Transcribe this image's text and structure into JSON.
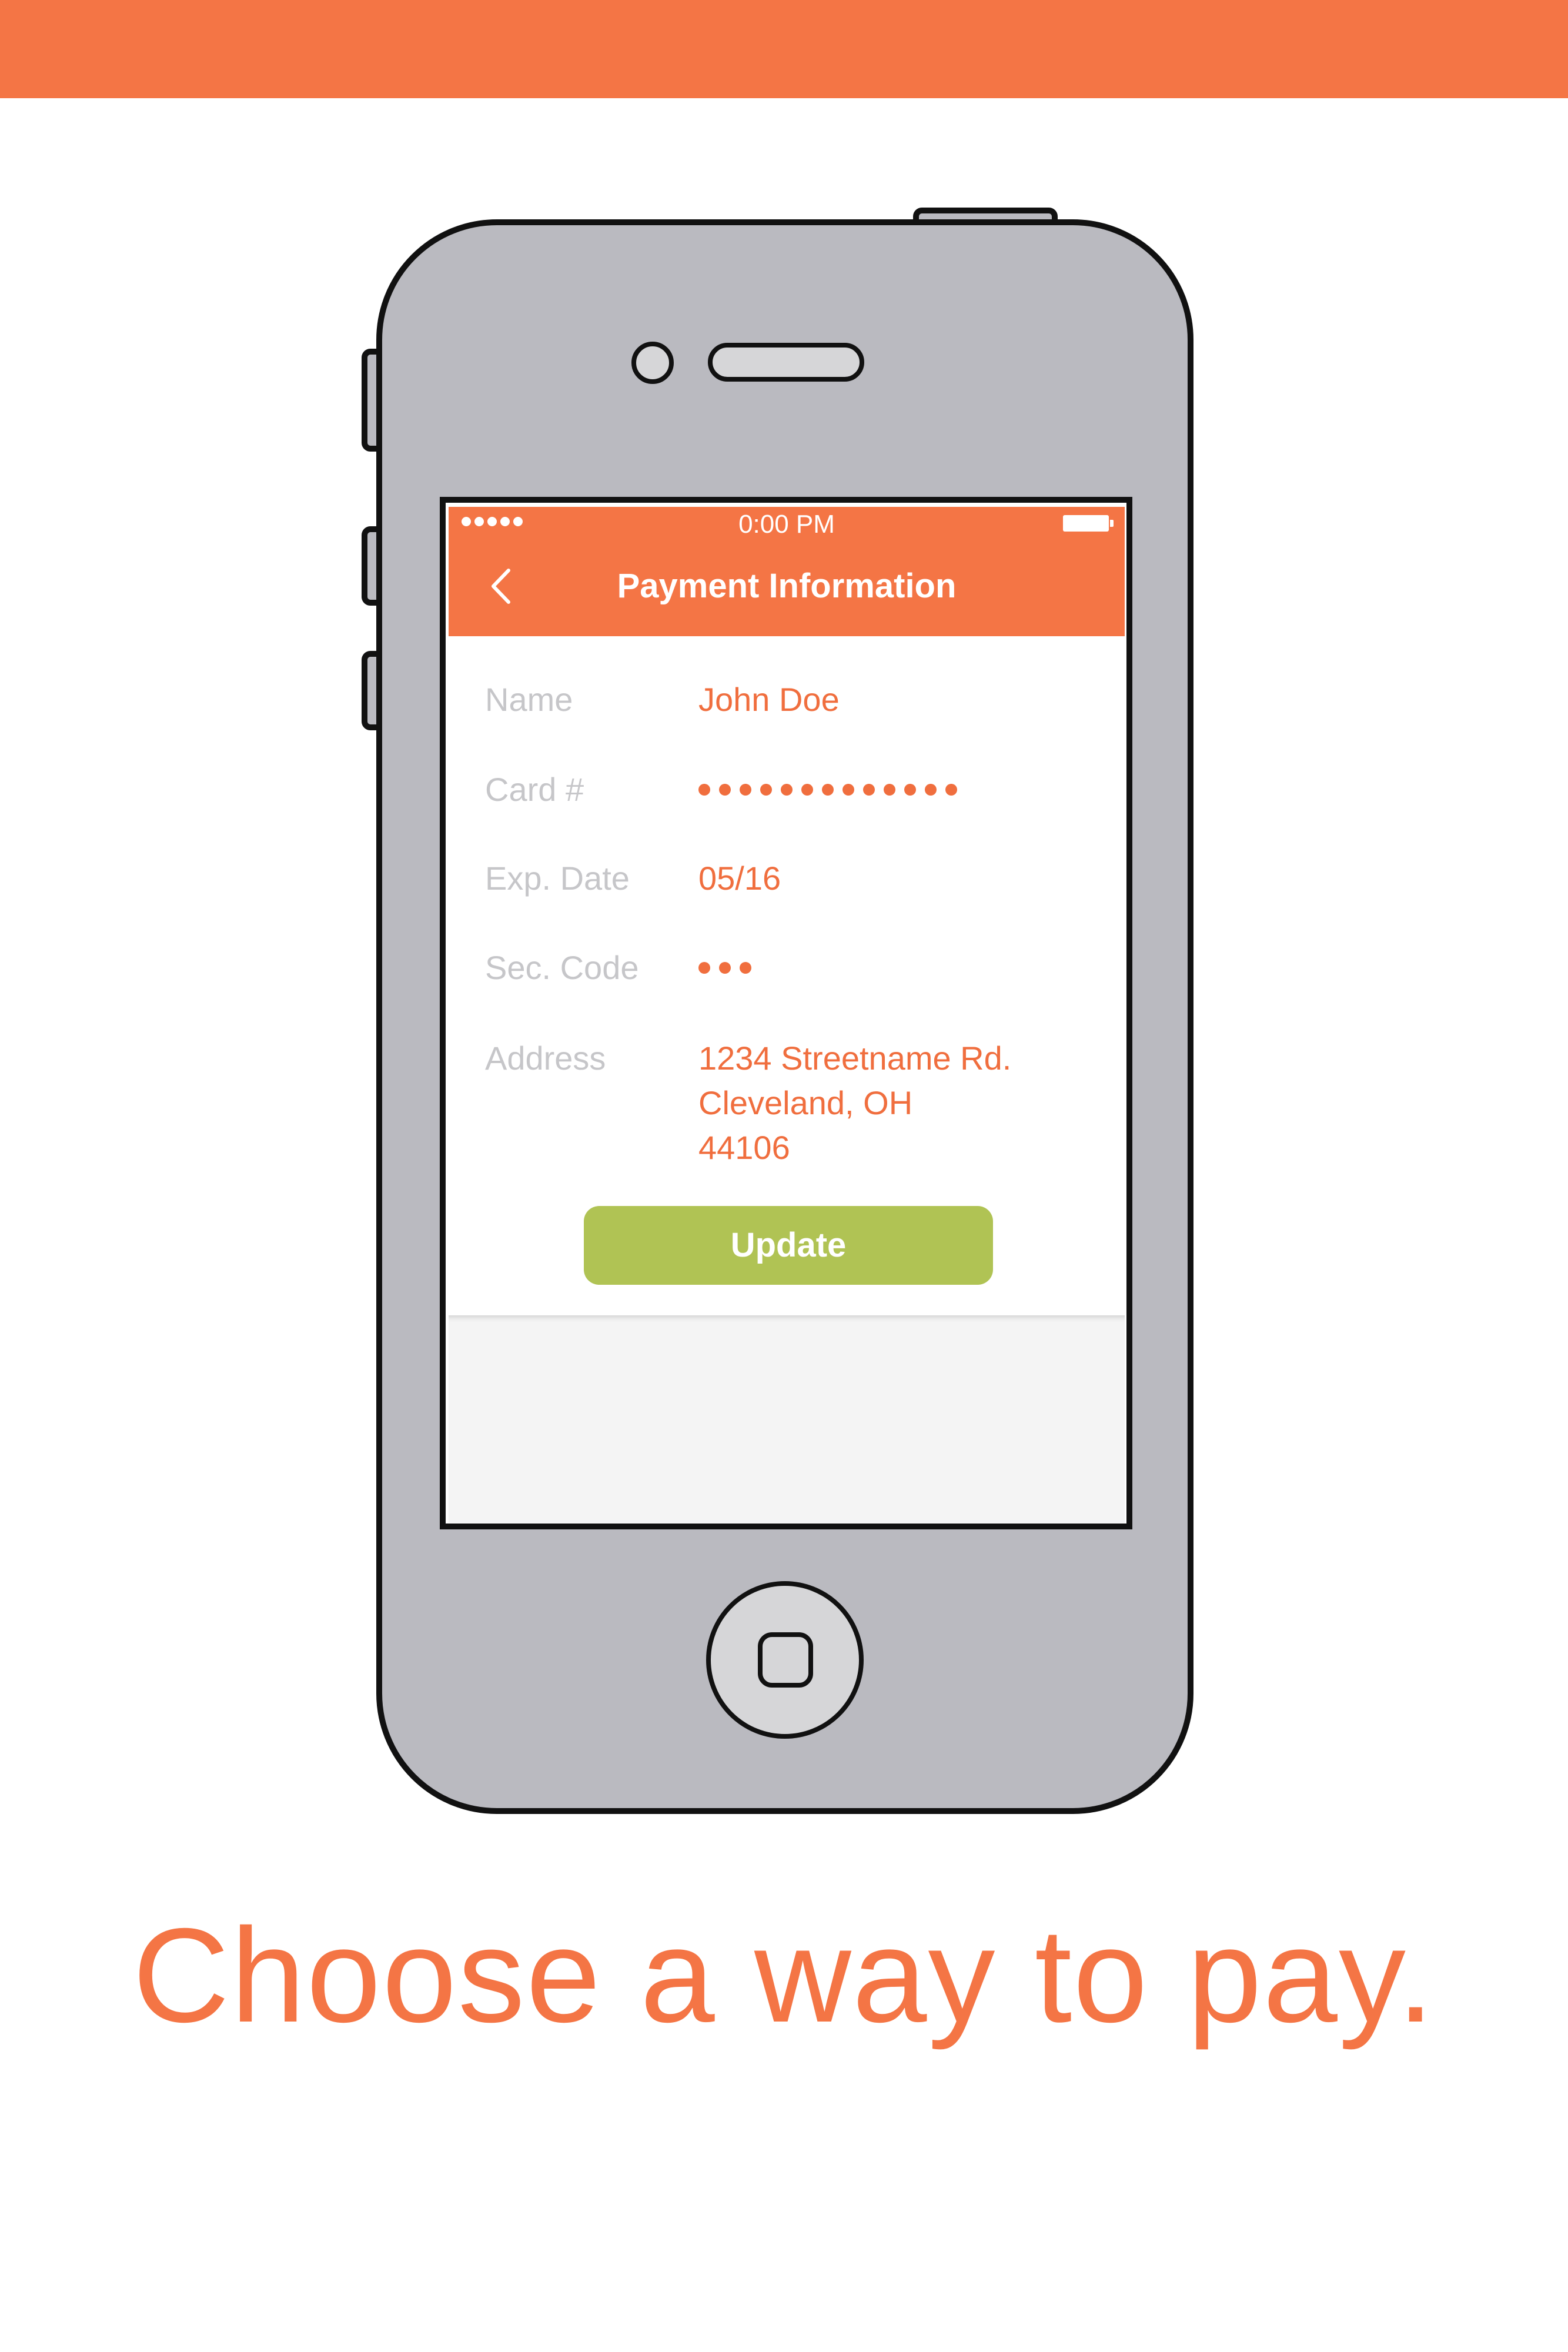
{
  "colors": {
    "accent": "#f47545",
    "button_green": "#b0c354",
    "label_gray": "#c6c6c9",
    "phone_body": "#babac0"
  },
  "status_bar": {
    "time": "0:00 PM",
    "signal_icon": "signal-dots-icon",
    "battery_icon": "battery-icon"
  },
  "header": {
    "back_icon": "chevron-left-icon",
    "title": "Payment Information"
  },
  "form": {
    "fields": [
      {
        "label": "Name",
        "value": "John Doe"
      },
      {
        "label": "Card #",
        "value": "•••••••••••••",
        "masked_length": 13
      },
      {
        "label": "Exp. Date",
        "value": "05/16"
      },
      {
        "label": "Sec. Code",
        "value": "•••",
        "masked_length": 3
      },
      {
        "label": "Address",
        "value_lines": [
          "1234 Streetname Rd.",
          "Cleveland, OH",
          "44106"
        ]
      }
    ],
    "update_label": "Update"
  },
  "tagline": "Choose a way to pay."
}
